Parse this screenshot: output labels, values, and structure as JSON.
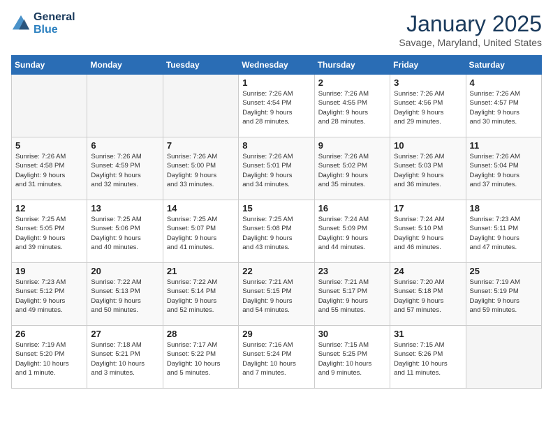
{
  "header": {
    "logo_line1": "General",
    "logo_line2": "Blue",
    "month": "January 2025",
    "location": "Savage, Maryland, United States"
  },
  "weekdays": [
    "Sunday",
    "Monday",
    "Tuesday",
    "Wednesday",
    "Thursday",
    "Friday",
    "Saturday"
  ],
  "weeks": [
    [
      {
        "day": "",
        "info": ""
      },
      {
        "day": "",
        "info": ""
      },
      {
        "day": "",
        "info": ""
      },
      {
        "day": "1",
        "info": "Sunrise: 7:26 AM\nSunset: 4:54 PM\nDaylight: 9 hours\nand 28 minutes."
      },
      {
        "day": "2",
        "info": "Sunrise: 7:26 AM\nSunset: 4:55 PM\nDaylight: 9 hours\nand 28 minutes."
      },
      {
        "day": "3",
        "info": "Sunrise: 7:26 AM\nSunset: 4:56 PM\nDaylight: 9 hours\nand 29 minutes."
      },
      {
        "day": "4",
        "info": "Sunrise: 7:26 AM\nSunset: 4:57 PM\nDaylight: 9 hours\nand 30 minutes."
      }
    ],
    [
      {
        "day": "5",
        "info": "Sunrise: 7:26 AM\nSunset: 4:58 PM\nDaylight: 9 hours\nand 31 minutes."
      },
      {
        "day": "6",
        "info": "Sunrise: 7:26 AM\nSunset: 4:59 PM\nDaylight: 9 hours\nand 32 minutes."
      },
      {
        "day": "7",
        "info": "Sunrise: 7:26 AM\nSunset: 5:00 PM\nDaylight: 9 hours\nand 33 minutes."
      },
      {
        "day": "8",
        "info": "Sunrise: 7:26 AM\nSunset: 5:01 PM\nDaylight: 9 hours\nand 34 minutes."
      },
      {
        "day": "9",
        "info": "Sunrise: 7:26 AM\nSunset: 5:02 PM\nDaylight: 9 hours\nand 35 minutes."
      },
      {
        "day": "10",
        "info": "Sunrise: 7:26 AM\nSunset: 5:03 PM\nDaylight: 9 hours\nand 36 minutes."
      },
      {
        "day": "11",
        "info": "Sunrise: 7:26 AM\nSunset: 5:04 PM\nDaylight: 9 hours\nand 37 minutes."
      }
    ],
    [
      {
        "day": "12",
        "info": "Sunrise: 7:25 AM\nSunset: 5:05 PM\nDaylight: 9 hours\nand 39 minutes."
      },
      {
        "day": "13",
        "info": "Sunrise: 7:25 AM\nSunset: 5:06 PM\nDaylight: 9 hours\nand 40 minutes."
      },
      {
        "day": "14",
        "info": "Sunrise: 7:25 AM\nSunset: 5:07 PM\nDaylight: 9 hours\nand 41 minutes."
      },
      {
        "day": "15",
        "info": "Sunrise: 7:25 AM\nSunset: 5:08 PM\nDaylight: 9 hours\nand 43 minutes."
      },
      {
        "day": "16",
        "info": "Sunrise: 7:24 AM\nSunset: 5:09 PM\nDaylight: 9 hours\nand 44 minutes."
      },
      {
        "day": "17",
        "info": "Sunrise: 7:24 AM\nSunset: 5:10 PM\nDaylight: 9 hours\nand 46 minutes."
      },
      {
        "day": "18",
        "info": "Sunrise: 7:23 AM\nSunset: 5:11 PM\nDaylight: 9 hours\nand 47 minutes."
      }
    ],
    [
      {
        "day": "19",
        "info": "Sunrise: 7:23 AM\nSunset: 5:12 PM\nDaylight: 9 hours\nand 49 minutes."
      },
      {
        "day": "20",
        "info": "Sunrise: 7:22 AM\nSunset: 5:13 PM\nDaylight: 9 hours\nand 50 minutes."
      },
      {
        "day": "21",
        "info": "Sunrise: 7:22 AM\nSunset: 5:14 PM\nDaylight: 9 hours\nand 52 minutes."
      },
      {
        "day": "22",
        "info": "Sunrise: 7:21 AM\nSunset: 5:15 PM\nDaylight: 9 hours\nand 54 minutes."
      },
      {
        "day": "23",
        "info": "Sunrise: 7:21 AM\nSunset: 5:17 PM\nDaylight: 9 hours\nand 55 minutes."
      },
      {
        "day": "24",
        "info": "Sunrise: 7:20 AM\nSunset: 5:18 PM\nDaylight: 9 hours\nand 57 minutes."
      },
      {
        "day": "25",
        "info": "Sunrise: 7:19 AM\nSunset: 5:19 PM\nDaylight: 9 hours\nand 59 minutes."
      }
    ],
    [
      {
        "day": "26",
        "info": "Sunrise: 7:19 AM\nSunset: 5:20 PM\nDaylight: 10 hours\nand 1 minute."
      },
      {
        "day": "27",
        "info": "Sunrise: 7:18 AM\nSunset: 5:21 PM\nDaylight: 10 hours\nand 3 minutes."
      },
      {
        "day": "28",
        "info": "Sunrise: 7:17 AM\nSunset: 5:22 PM\nDaylight: 10 hours\nand 5 minutes."
      },
      {
        "day": "29",
        "info": "Sunrise: 7:16 AM\nSunset: 5:24 PM\nDaylight: 10 hours\nand 7 minutes."
      },
      {
        "day": "30",
        "info": "Sunrise: 7:15 AM\nSunset: 5:25 PM\nDaylight: 10 hours\nand 9 minutes."
      },
      {
        "day": "31",
        "info": "Sunrise: 7:15 AM\nSunset: 5:26 PM\nDaylight: 10 hours\nand 11 minutes."
      },
      {
        "day": "",
        "info": ""
      }
    ]
  ]
}
